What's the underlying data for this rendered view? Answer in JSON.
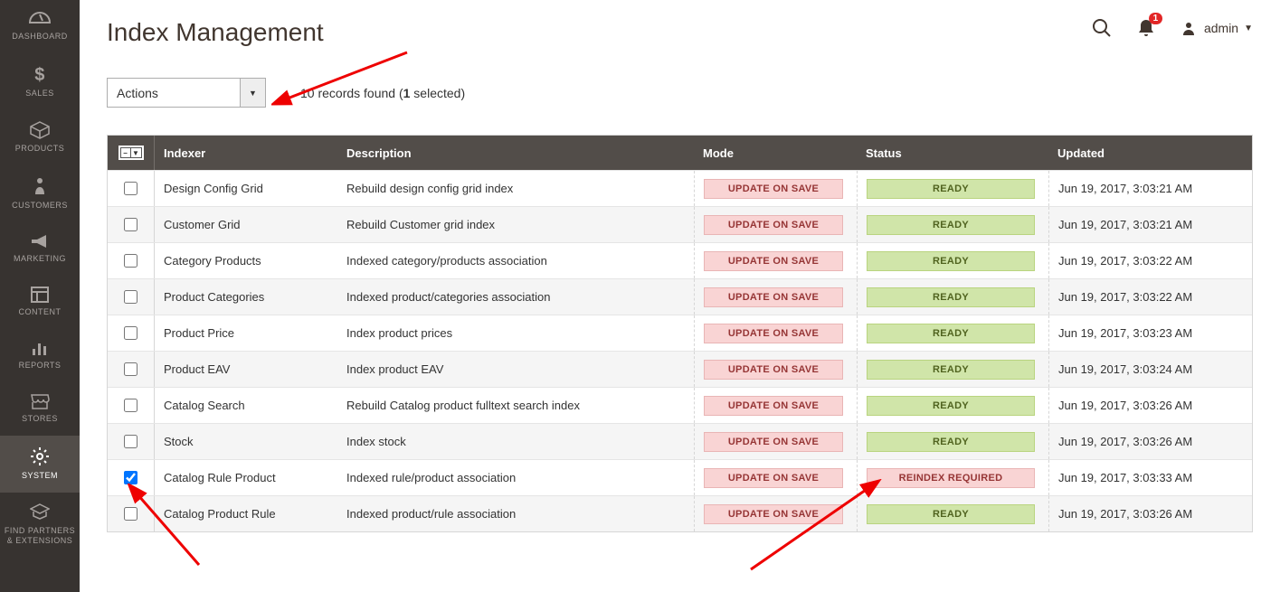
{
  "sidebar": {
    "items": [
      {
        "label": "DASHBOARD",
        "icon": "dashboard"
      },
      {
        "label": "SALES",
        "icon": "dollar"
      },
      {
        "label": "PRODUCTS",
        "icon": "box"
      },
      {
        "label": "CUSTOMERS",
        "icon": "person"
      },
      {
        "label": "MARKETING",
        "icon": "megaphone"
      },
      {
        "label": "CONTENT",
        "icon": "layout"
      },
      {
        "label": "REPORTS",
        "icon": "chart"
      },
      {
        "label": "STORES",
        "icon": "store"
      },
      {
        "label": "SYSTEM",
        "icon": "gear"
      },
      {
        "label": "FIND PARTNERS\n& EXTENSIONS",
        "icon": "partners"
      }
    ]
  },
  "header": {
    "title": "Index Management",
    "user": "admin",
    "notif_count": "1"
  },
  "actions": {
    "dropdown_label": "Actions",
    "records_found_prefix": "10 records found (",
    "records_found_bold": "1",
    "records_found_suffix": " selected)"
  },
  "grid": {
    "headers": {
      "indexer": "Indexer",
      "description": "Description",
      "mode": "Mode",
      "status": "Status",
      "updated": "Updated"
    },
    "rows": [
      {
        "checked": false,
        "indexer": "Design Config Grid",
        "desc": "Rebuild design config grid index",
        "mode": "UPDATE ON SAVE",
        "status": "READY",
        "status_type": "green",
        "updated": "Jun 19, 2017, 3:03:21 AM"
      },
      {
        "checked": false,
        "indexer": "Customer Grid",
        "desc": "Rebuild Customer grid index",
        "mode": "UPDATE ON SAVE",
        "status": "READY",
        "status_type": "green",
        "updated": "Jun 19, 2017, 3:03:21 AM"
      },
      {
        "checked": false,
        "indexer": "Category Products",
        "desc": "Indexed category/products association",
        "mode": "UPDATE ON SAVE",
        "status": "READY",
        "status_type": "green",
        "updated": "Jun 19, 2017, 3:03:22 AM"
      },
      {
        "checked": false,
        "indexer": "Product Categories",
        "desc": "Indexed product/categories association",
        "mode": "UPDATE ON SAVE",
        "status": "READY",
        "status_type": "green",
        "updated": "Jun 19, 2017, 3:03:22 AM"
      },
      {
        "checked": false,
        "indexer": "Product Price",
        "desc": "Index product prices",
        "mode": "UPDATE ON SAVE",
        "status": "READY",
        "status_type": "green",
        "updated": "Jun 19, 2017, 3:03:23 AM"
      },
      {
        "checked": false,
        "indexer": "Product EAV",
        "desc": "Index product EAV",
        "mode": "UPDATE ON SAVE",
        "status": "READY",
        "status_type": "green",
        "updated": "Jun 19, 2017, 3:03:24 AM"
      },
      {
        "checked": false,
        "indexer": "Catalog Search",
        "desc": "Rebuild Catalog product fulltext search index",
        "mode": "UPDATE ON SAVE",
        "status": "READY",
        "status_type": "green",
        "updated": "Jun 19, 2017, 3:03:26 AM"
      },
      {
        "checked": false,
        "indexer": "Stock",
        "desc": "Index stock",
        "mode": "UPDATE ON SAVE",
        "status": "READY",
        "status_type": "green",
        "updated": "Jun 19, 2017, 3:03:26 AM"
      },
      {
        "checked": true,
        "indexer": "Catalog Rule Product",
        "desc": "Indexed rule/product association",
        "mode": "UPDATE ON SAVE",
        "status": "REINDEX REQUIRED",
        "status_type": "red",
        "updated": "Jun 19, 2017, 3:03:33 AM"
      },
      {
        "checked": false,
        "indexer": "Catalog Product Rule",
        "desc": "Indexed product/rule association",
        "mode": "UPDATE ON SAVE",
        "status": "READY",
        "status_type": "green",
        "updated": "Jun 19, 2017, 3:03:26 AM"
      }
    ]
  }
}
